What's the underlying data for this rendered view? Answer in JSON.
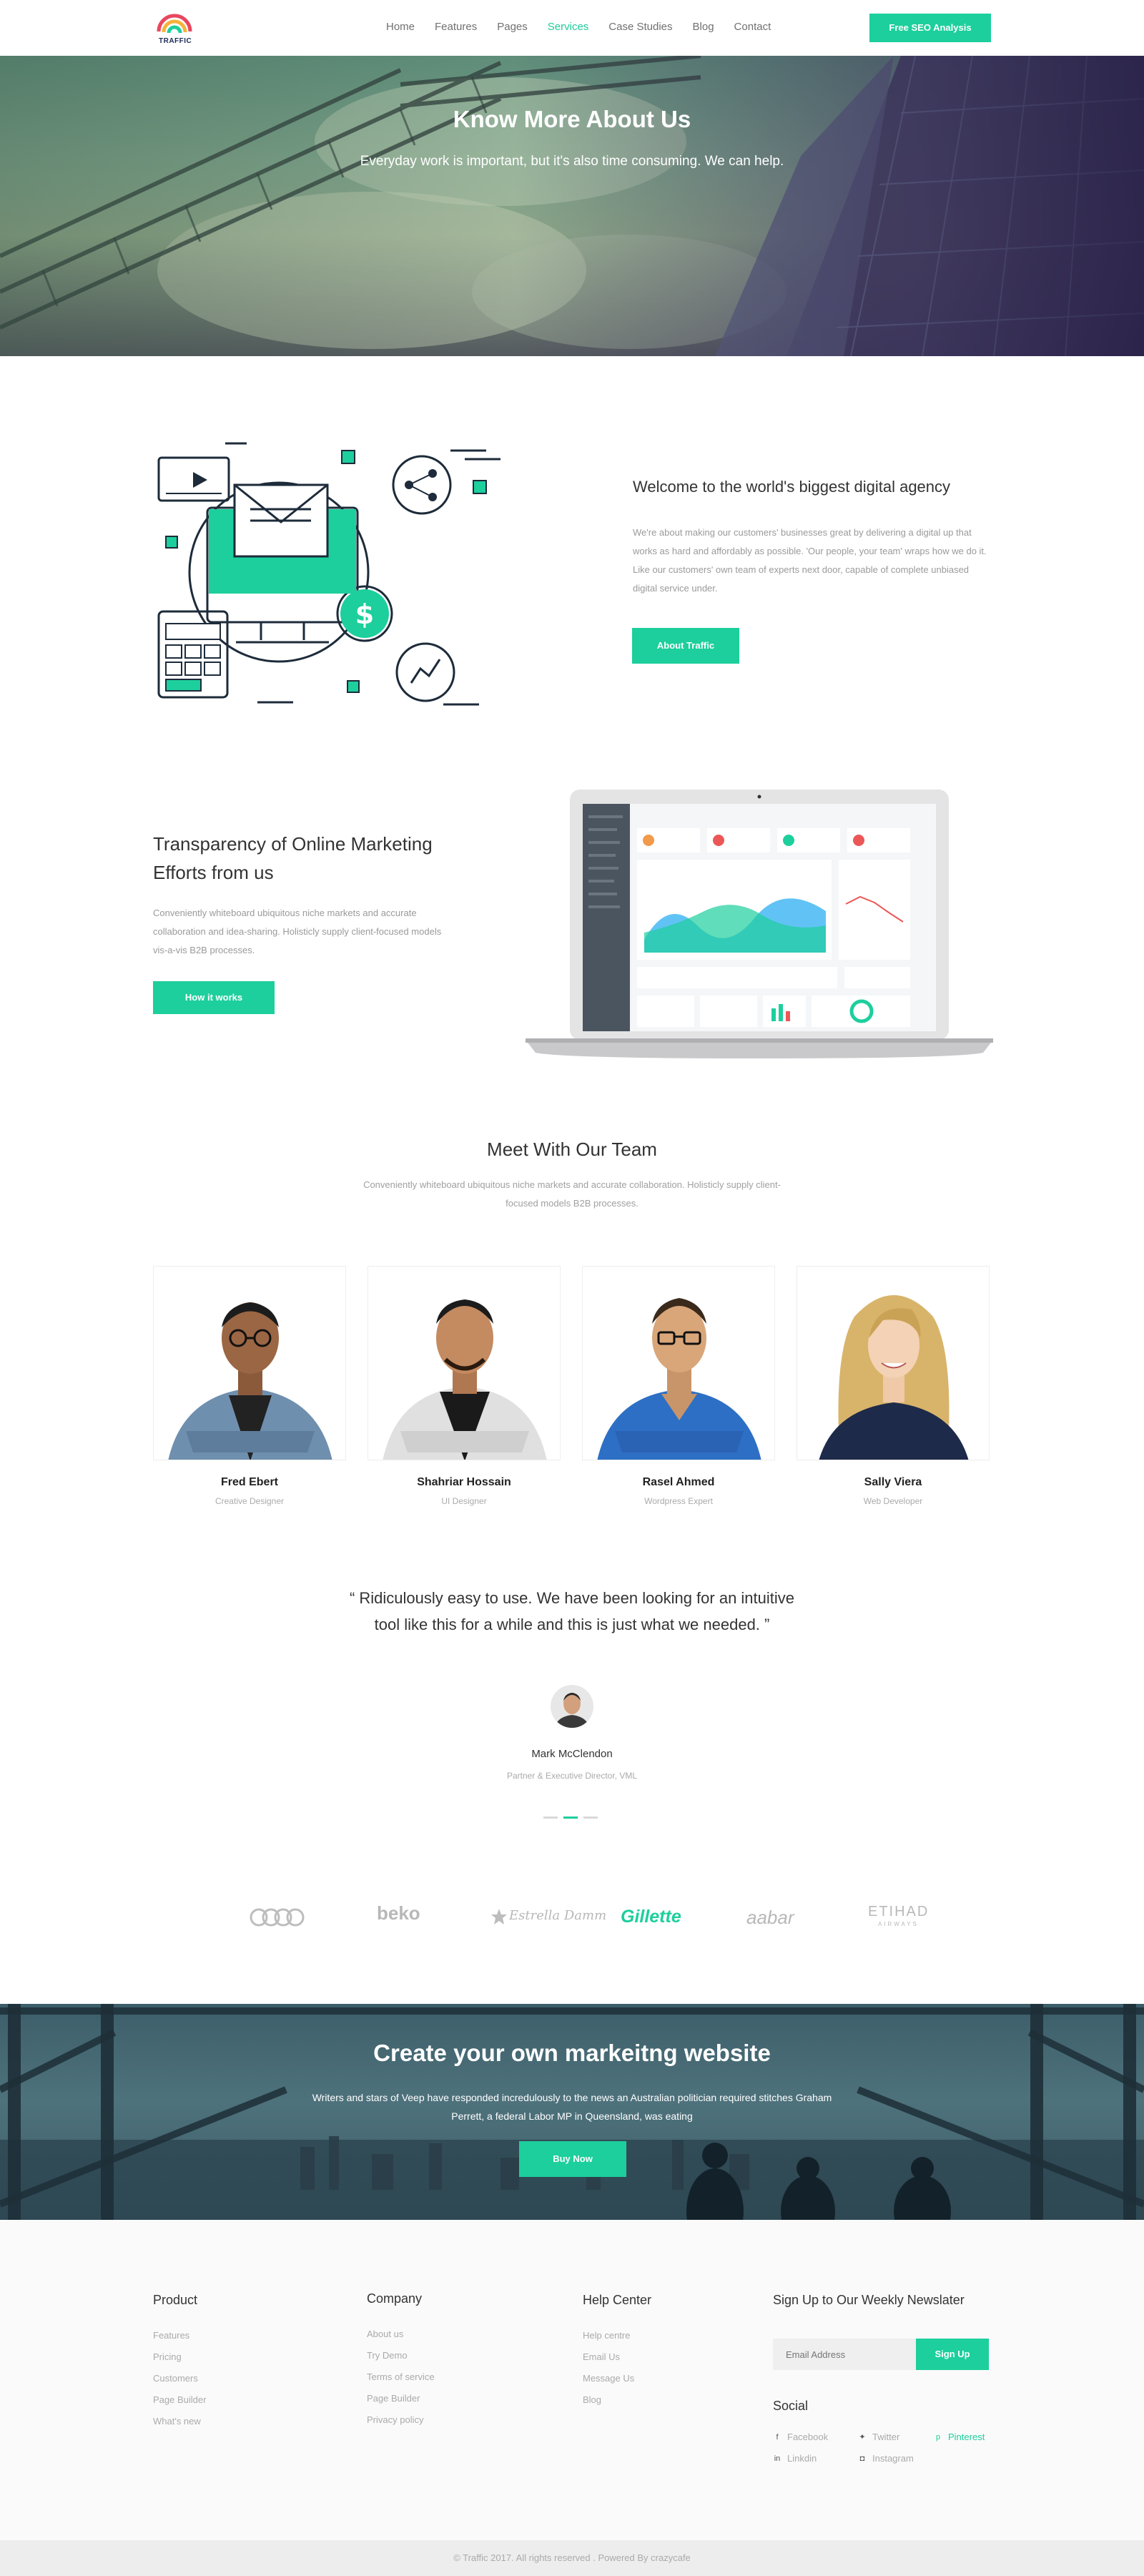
{
  "header": {
    "logo_text": "TRAFFIC",
    "nav": [
      {
        "label": "Home",
        "active": false
      },
      {
        "label": "Features",
        "active": false
      },
      {
        "label": "Pages",
        "active": false
      },
      {
        "label": "Services",
        "active": true
      },
      {
        "label": "Case Studies",
        "active": false
      },
      {
        "label": "Blog",
        "active": false
      },
      {
        "label": "Contact",
        "active": false
      }
    ],
    "cta_label": "Free SEO Analysis"
  },
  "hero": {
    "title": "Know More About Us",
    "subtitle": "Everyday work is important, but it's also time consuming. We can help."
  },
  "intro": {
    "title": "Welcome to the world's biggest digital agency",
    "text": "We're about making our customers' businesses great by delivering a digital up that works as hard and affordably as possible. 'Our people, your team' wraps how we do it. Like our customers' own team of experts next door, capable of complete unbiased digital service under.",
    "button": "About Traffic"
  },
  "transparency": {
    "title": "Transparency of Online Marketing Efforts from us",
    "text": "Conveniently whiteboard ubiquitous niche markets and accurate collaboration and idea-sharing. Holisticly supply client-focused models vis-a-vis B2B processes.",
    "button": "How it works"
  },
  "team": {
    "title": "Meet With Our Team",
    "subtitle": "Conveniently whiteboard ubiquitous niche markets and accurate collaboration. Holisticly supply client-focused models B2B processes.",
    "members": [
      {
        "name": "Fred Ebert",
        "role": "Creative Designer"
      },
      {
        "name": "Shahriar Hossain",
        "role": "UI Designer"
      },
      {
        "name": "Rasel Ahmed",
        "role": "Wordpress Expert"
      },
      {
        "name": "Sally Viera",
        "role": "Web Developer"
      }
    ]
  },
  "testimonial": {
    "quote": "“ Ridiculously easy to use. We have been looking for an intuitive tool like this for a while and this is just what we needed. ”",
    "name": "Mark McClendon",
    "role": "Partner & Executive Director, VML"
  },
  "brands": [
    "beko",
    "Estrella Damm",
    "Gillette",
    "aabar",
    "ETIHAD",
    "AIRWAYS"
  ],
  "cta": {
    "title": "Create your own markeitng website",
    "text": "Writers and stars of Veep have responded incredulously to the news an Australian politician required stitches Graham Perrett, a federal Labor MP in Queensland, was eating",
    "button": "Buy Now"
  },
  "footer": {
    "product": {
      "title": "Product",
      "links": [
        "Features",
        "Pricing",
        "Customers",
        "Page Builder",
        "What's new"
      ]
    },
    "company": {
      "title": "Company",
      "links": [
        "About us",
        "Try Demo",
        "Terms of service",
        "Page Builder",
        "Privacy policy"
      ]
    },
    "help": {
      "title": "Help Center",
      "links": [
        "Help centre",
        "Email Us",
        "Message Us",
        "Blog"
      ]
    },
    "newsletter": {
      "title": "Sign Up to Our Weekly Newslater",
      "placeholder": "Email Address",
      "button": "Sign Up"
    },
    "social": {
      "title": "Social",
      "items": [
        {
          "label": "Facebook",
          "icon": "facebook-icon"
        },
        {
          "label": "Twitter",
          "icon": "twitter-icon"
        },
        {
          "label": "Pinterest",
          "icon": "pinterest-icon"
        },
        {
          "label": "Linkdin",
          "icon": "linkedin-icon"
        },
        {
          "label": "Instagram",
          "icon": "instagram-icon"
        }
      ]
    },
    "copyright": "© Traffic 2017. All rights reserved . Powered By crazycafe"
  },
  "colors": {
    "accent": "#1dcf9c",
    "heading": "#333333",
    "muted": "#9a9a9a",
    "footer_bg": "#fafafa"
  }
}
